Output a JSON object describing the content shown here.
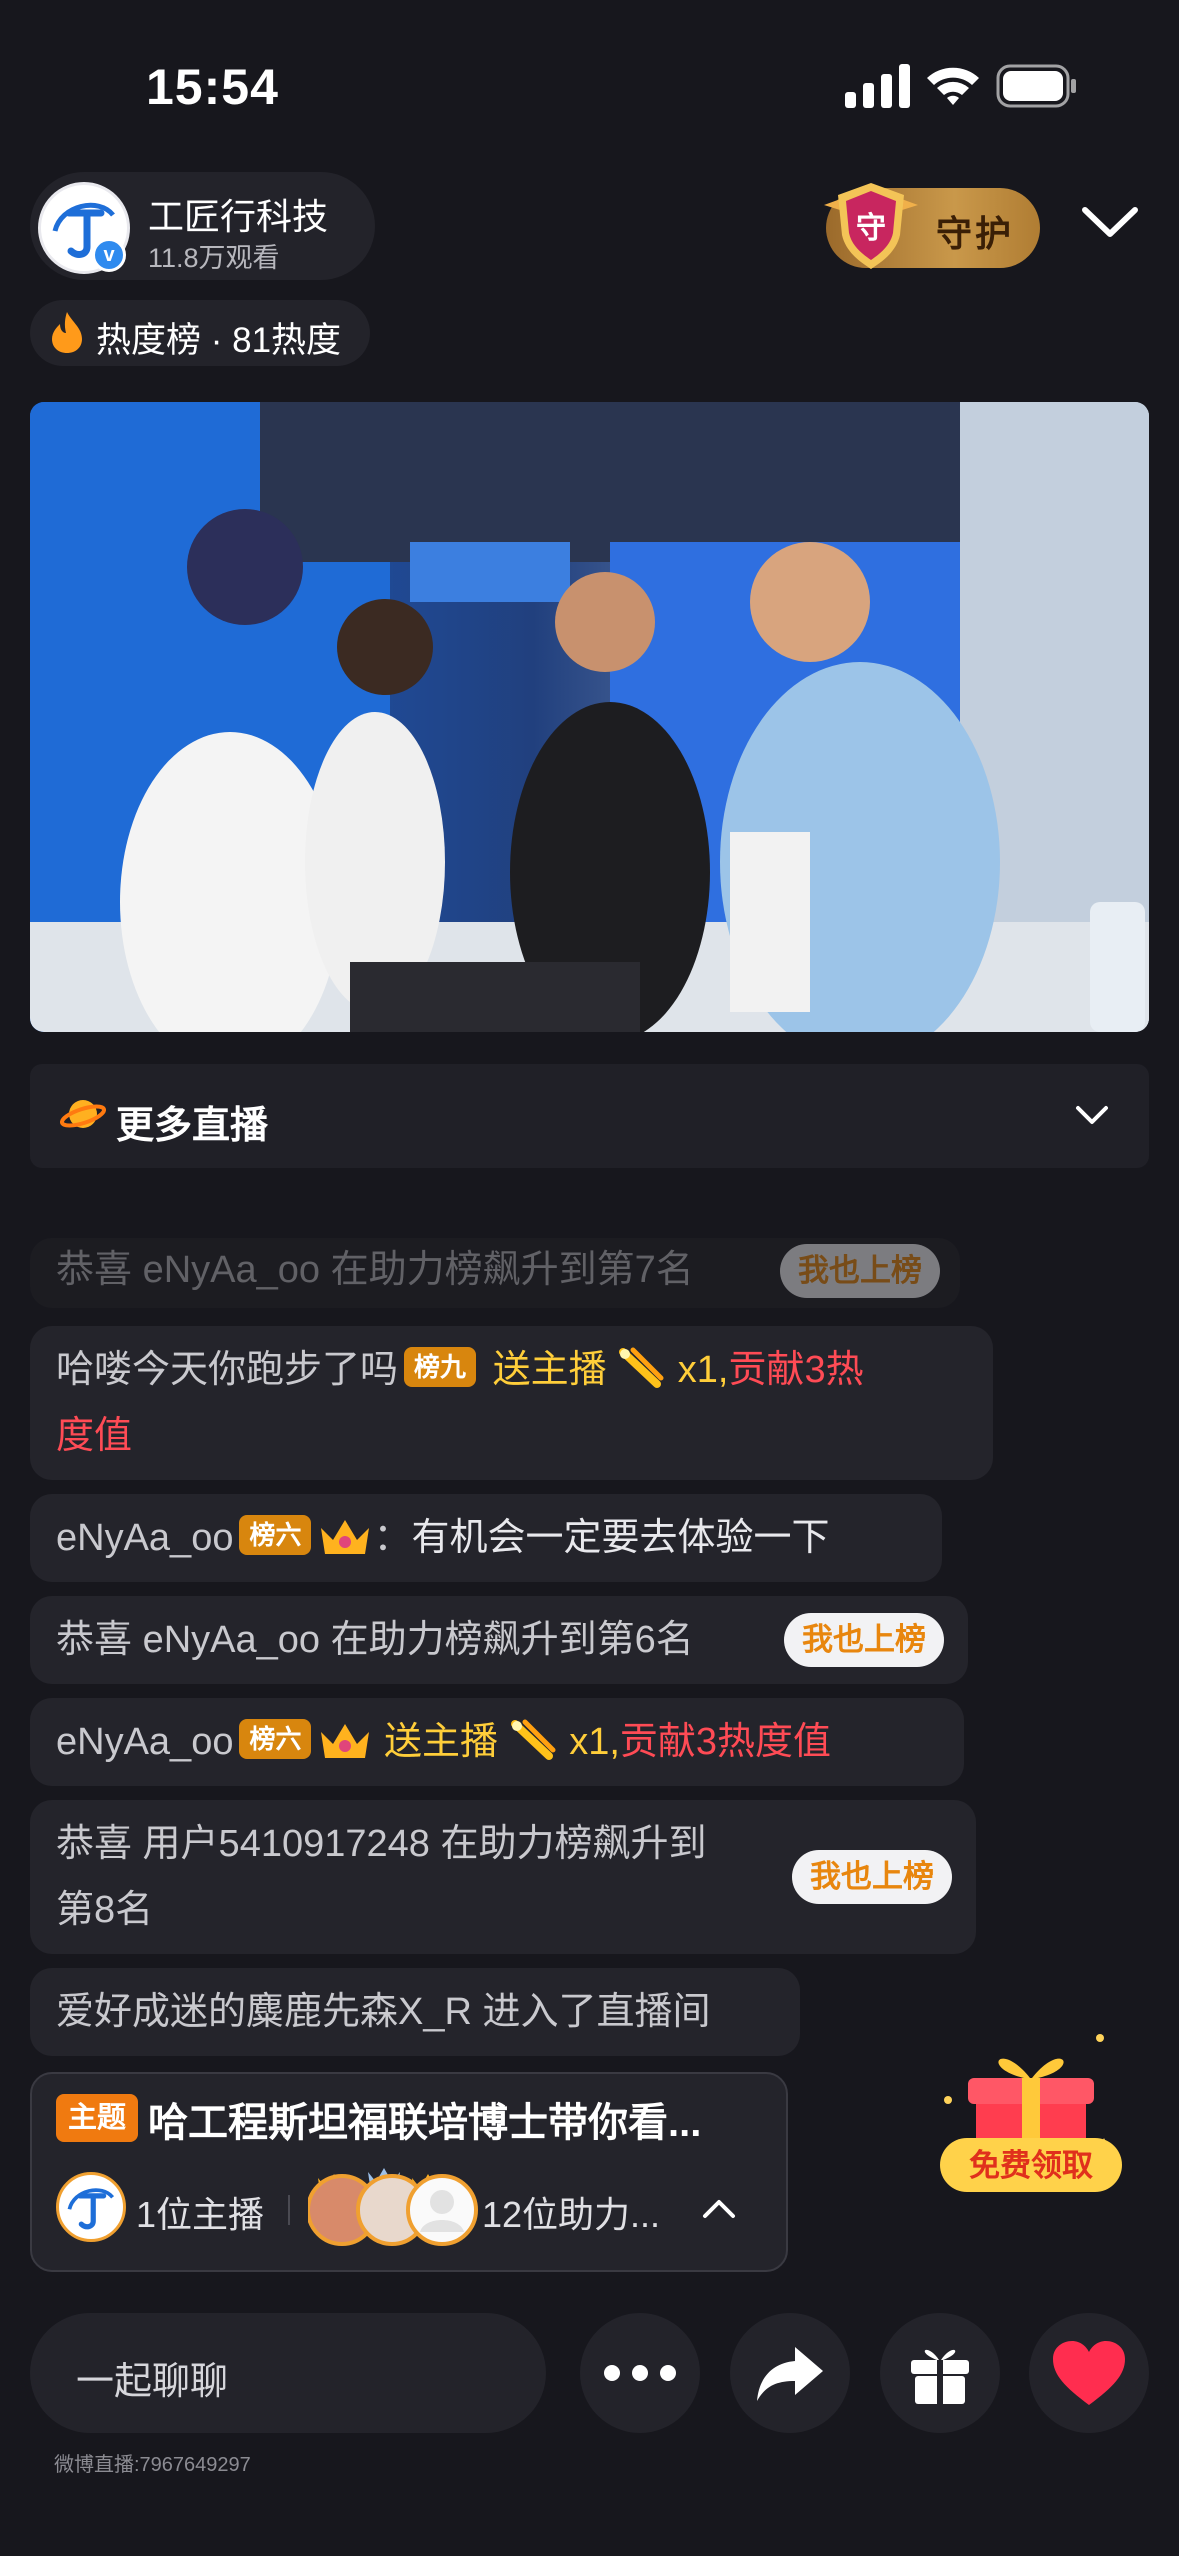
{
  "status_bar": {
    "time": "15:54"
  },
  "host": {
    "name": "工匠行科技",
    "viewers": "11.8万观看",
    "verified_mark": "v"
  },
  "guard": {
    "shield_char": "守",
    "label": "守护"
  },
  "hot_rank": {
    "text": "热度榜 · 81热度"
  },
  "more_live": {
    "label": "更多直播"
  },
  "chat": {
    "faded": {
      "prefix": "恭喜 ",
      "user": "eNyAa_oo",
      "text": " 在助力榜飙升到第7名",
      "button": "我也上榜"
    },
    "msg1": {
      "user": "哈喽今天你跑步了吗",
      "rank": "榜九",
      "gift": "送主播",
      "count": "x1,",
      "contrib": "贡献3热",
      "contrib2": "度值"
    },
    "msg2": {
      "user": "eNyAa_oo",
      "rank": "榜六",
      "sep": "：",
      "text": "有机会一定要去体验一下"
    },
    "msg3": {
      "prefix": "恭喜 ",
      "user": "eNyAa_oo",
      "text": " 在助力榜飙升到第6名",
      "button": "我也上榜"
    },
    "msg4": {
      "user": "eNyAa_oo",
      "rank": "榜六",
      "gift": "送主播",
      "count": "x1,",
      "contrib": "贡献3热度值"
    },
    "msg5": {
      "line1": "恭喜 用户5410917248 在助力榜飙升到",
      "line2": "第8名",
      "button": "我也上榜"
    },
    "msg6": {
      "text": "爱好成迷的麋鹿先森X_R 进入了直播间"
    }
  },
  "topic": {
    "badge": "主题",
    "title": "哈工程斯坦福联培博士带你看...",
    "host_count": "1位主播",
    "helpers_count": "12位助力..."
  },
  "gift_promo": {
    "label": "免费领取"
  },
  "bottom_bar": {
    "placeholder": "一起聊聊",
    "room_id": "微博直播:7967649297"
  },
  "colors": {
    "accent_orange": "#f07a10",
    "gift_red": "#ff4b55",
    "gift_yellow": "#ffce3a",
    "like_red": "#ff2d4f"
  }
}
